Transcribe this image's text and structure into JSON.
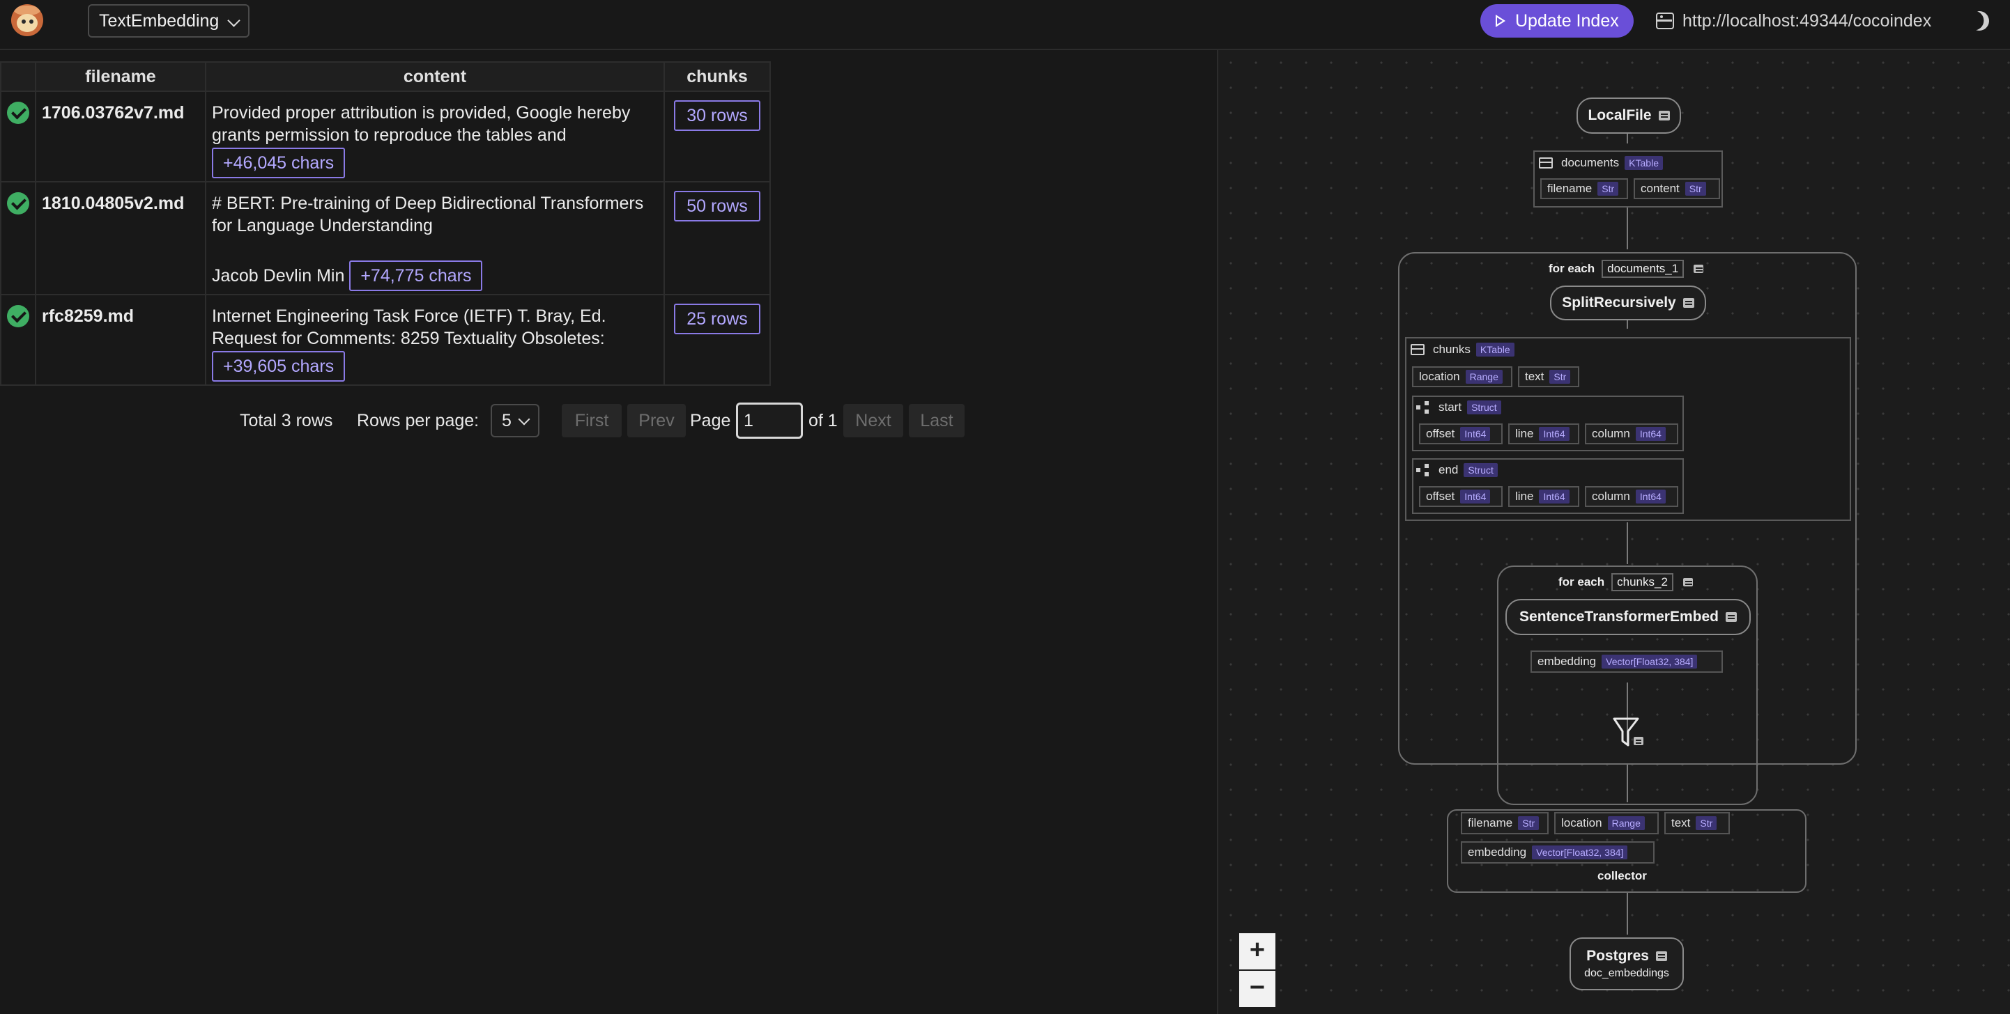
{
  "header": {
    "flow_name": "TextEmbedding",
    "update_label": "Update Index",
    "server_url": "http://localhost:49344/cocoindex"
  },
  "table": {
    "columns": [
      "filename",
      "content",
      "chunks"
    ],
    "rows": [
      {
        "filename": "1706.03762v7.md",
        "content_line1": "Provided proper attribution is provided, Google hereby",
        "content_line2": "grants permission to reproduce the tables and",
        "content_line3": "",
        "more_chars": "+46,045 chars",
        "chunks": "30 rows"
      },
      {
        "filename": "1810.04805v2.md",
        "content_line1": "# BERT: Pre-training of Deep Bidirectional Transformers",
        "content_line2": "for Language Understanding",
        "content_line3": "Jacob Devlin Min",
        "more_chars": "+74,775 chars",
        "chunks": "50 rows"
      },
      {
        "filename": "rfc8259.md",
        "content_line1": "Internet Engineering Task Force (IETF) T. Bray, Ed.",
        "content_line2": "Request for Comments: 8259 Textuality Obsoletes:",
        "content_line3": "",
        "more_chars": "+39,605 chars",
        "chunks": "25 rows"
      }
    ]
  },
  "pagination": {
    "total": "Total 3 rows",
    "rows_per_page_label": "Rows per page:",
    "rows_per_page": "5",
    "first": "First",
    "prev": "Prev",
    "page_label": "Page",
    "page_value": "1",
    "of_label": "of 1",
    "next": "Next",
    "last": "Last"
  },
  "graph": {
    "source": {
      "name": "LocalFile"
    },
    "documents": {
      "name": "documents",
      "type": "KTable",
      "fields": [
        {
          "name": "filename",
          "type": "Str"
        },
        {
          "name": "content",
          "type": "Str"
        }
      ]
    },
    "foreach1": {
      "label": "for each",
      "var": "documents_1"
    },
    "split": {
      "name": "SplitRecursively"
    },
    "chunks": {
      "name": "chunks",
      "type": "KTable",
      "location": {
        "name": "location",
        "type": "Range"
      },
      "text": {
        "name": "text",
        "type": "Str"
      },
      "start": {
        "name": "start",
        "type": "Struct",
        "offset": {
          "name": "offset",
          "type": "Int64"
        },
        "line": {
          "name": "line",
          "type": "Int64"
        },
        "column": {
          "name": "column",
          "type": "Int64"
        }
      },
      "end": {
        "name": "end",
        "type": "Struct",
        "offset": {
          "name": "offset",
          "type": "Int64"
        },
        "line": {
          "name": "line",
          "type": "Int64"
        },
        "column": {
          "name": "column",
          "type": "Int64"
        }
      }
    },
    "foreach2": {
      "label": "for each",
      "var": "chunks_2"
    },
    "embed": {
      "name": "SentenceTransformerEmbed",
      "field": {
        "name": "embedding",
        "type": "Vector[Float32, 384]"
      }
    },
    "collector": {
      "label": "collector",
      "filename": {
        "name": "filename",
        "type": "Str"
      },
      "location": {
        "name": "location",
        "type": "Range"
      },
      "text": {
        "name": "text",
        "type": "Str"
      },
      "embedding": {
        "name": "embedding",
        "type": "Vector[Float32, 384]"
      }
    },
    "target": {
      "name": "Postgres",
      "table": "doc_embeddings"
    },
    "zoom_in": "+",
    "zoom_out": "−"
  }
}
